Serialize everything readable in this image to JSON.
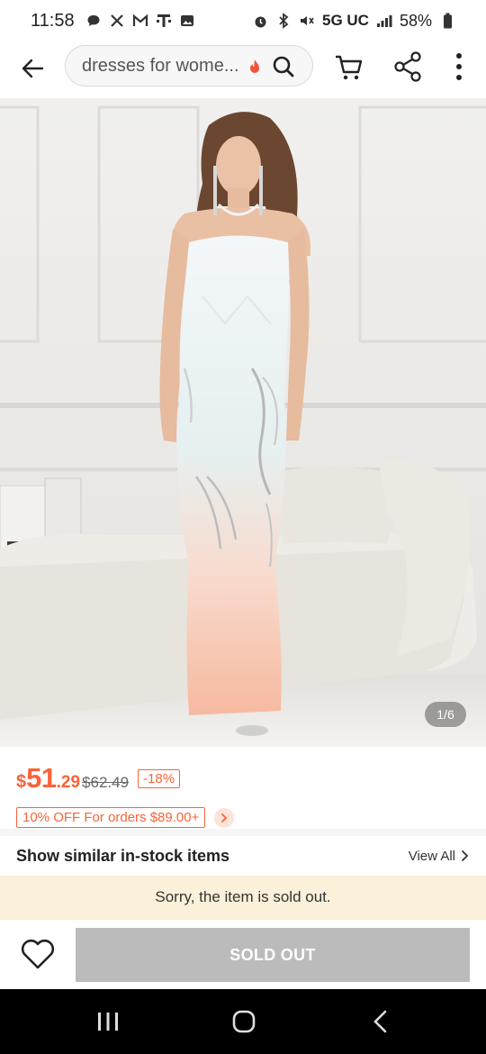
{
  "status_bar": {
    "time": "11:58",
    "network": "5G UC",
    "battery": "58%",
    "left_icons": [
      "chat-bubble-icon",
      "x-logo-icon",
      "gmail-icon",
      "tmobile-icon",
      "gallery-icon"
    ],
    "right_icons": [
      "alarm-icon",
      "bluetooth-icon",
      "mute-icon",
      "signal-icon",
      "battery-icon"
    ]
  },
  "header": {
    "search_text": "dresses for wome...",
    "icons": [
      "back-arrow-icon",
      "flame-icon",
      "search-icon",
      "cart-icon",
      "share-icon",
      "more-vertical-icon"
    ]
  },
  "product_image": {
    "counter": "1/6"
  },
  "price": {
    "currency": "$",
    "integer": "51",
    "decimal": ".29",
    "original": "$62.49",
    "discount": "-18%"
  },
  "promo": {
    "label": "10% OFF For orders $89.00+"
  },
  "similar": {
    "title": "Show similar in-stock items",
    "view_all": "View All"
  },
  "sold_out_banner": "Sorry, the item is sold out.",
  "bottom_bar": {
    "button_label": "SOLD OUT"
  },
  "colors": {
    "accent": "#fa6338",
    "banner_bg": "#fbf0d9",
    "disabled_button": "#bbbbbb"
  }
}
